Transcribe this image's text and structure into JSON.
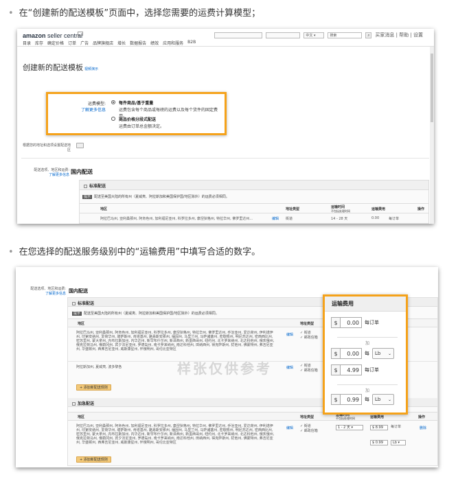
{
  "bullets": [
    "在“创建新的配送模板”页面中，选择您需要的运费计算模型；",
    "在您选择的配送服务级别中的“运输费用”中填写合适的数字。"
  ],
  "shot1": {
    "logo_brand": "amazon",
    "logo_product": " seller central",
    "top_right": {
      "store_select": "",
      "lang_select": "中文",
      "search_placeholder": "搜索",
      "links": "买家消息 | 帮助 | 设置"
    },
    "nav": [
      "目录",
      "库存",
      "确定价格",
      "订单",
      "广告",
      "品牌旗舰店",
      "增长",
      "数据报告",
      "绩效",
      "应用和服务",
      "B2B"
    ],
    "page_title": "创建新的配送模板",
    "page_title_help": "视频演示",
    "model": {
      "label": "运费模型:",
      "more": "了解更多信息",
      "opt1_title": "每件商品/基于重量",
      "opt1_desc": "运费包含每个商品或每磅的运费以及每个货件的固定费用。",
      "opt2_title": "商品价格分段式配送",
      "opt2_desc": "运费由订单总金额决定。"
    },
    "dest_label": "根据您的地址和选项设置配送地区",
    "ship_opts_label": "配送选项、地区和运费:",
    "ship_opts_more": "了解更多信息",
    "domestic": "国内配送",
    "standard": "标准配送",
    "notice_tag": "提示",
    "notice": "配送至美国大陆的所有州（夏威夷、阿拉斯加和美国保护国/地区除外）的运费必须相同。",
    "table_headers": [
      "地区",
      "地址类型",
      "运输时间",
      "运输费用",
      "操作"
    ],
    "transit_sub": "不包括处理时间",
    "row": {
      "region": "阿拉巴马州, 亚利桑那州, 阿肯色州, 加利福尼亚州, 科罗拉多州, 康涅狄格州, 特拉华州, 佛罗里达州...",
      "edit": "编辑",
      "addr": "街道",
      "transit": "14 - 28 天",
      "fee": "0.00",
      "fee_unit": "每订单"
    }
  },
  "shot2": {
    "ship_opts_label": "配送选项、地区和运费:",
    "ship_opts_more": "了解更多信息",
    "domestic": "国内配送",
    "standard": "标准配送",
    "expedited": "加急配送",
    "notice_tag": "提示",
    "notice": "配送至美国大陆的所有州（夏威夷、阿拉斯加和美国保护国/地区除外）的运费必须相同。",
    "table_headers": [
      "地区",
      "地址类型",
      "运输时间",
      "运输费用",
      "操作"
    ],
    "transit_sub": "不包括处理时间",
    "region1": "阿拉巴马州, 亚利桑那州, 阿肯色州, 加利福尼亚州, 科罗拉多州, 康涅狄格州, 特拉华州, 佛罗里达州, 乔治亚州, 爱达荷州, 伊利诺伊州, 印第安纳州, 爱荷华州, 堪萨斯州, 肯塔基州, 路易斯安那州, 缅因州, 马里兰州, 马萨诸塞州, 密歇根州, 明尼苏达州, 密西西比州, 密苏里州, 蒙大拿州, 内布拉斯加州, 内华达州, 新罕布什尔州, 新泽西州, 新墨西哥州, 纽约州, 北卡罗来纳州, 北达科他州, 俄亥俄州, 俄克拉荷马州, 俄勒冈州, 宾夕法尼亚州, 罗德岛州, 南卡罗来纳州, 南达科他州, 田纳西州, 得克萨斯州, 犹他州, 佛蒙特州, 弗吉尼亚州, 华盛顿州, 西弗吉尼亚州, 威斯康星州, 怀俄明州, 哥伦比亚特区",
    "region2": "阿拉斯加州, 夏威夷, 波多黎各",
    "edit": "编辑",
    "addr1": "街道",
    "addr2": "邮政信箱",
    "transit_days": "14",
    "add_rule": "+ 添加新配送规则",
    "expedited_transit": "1 - 2 天",
    "exp_fee1": "8.99",
    "exp_fee1_unit": "每订单",
    "exp_fee2": "0.99",
    "exp_fee2_unit": "Lb",
    "delete": "删除",
    "watermark": "样张仅供参考",
    "fee_box": {
      "title": "运输费用",
      "currency": "$",
      "plus": "加",
      "row1_value": "0.00",
      "row1_unit": "每订单",
      "row2_value": "0.00",
      "row2_per": "每",
      "row2_unit": "Lb",
      "row3_value": "4.99",
      "row3_unit": "每订单",
      "row4_value": "0.99",
      "row4_per": "每",
      "row4_unit": "Lb"
    }
  },
  "colors": {
    "highlight": "#f5a21a",
    "link": "#0066c0",
    "add_button": "#f3c979"
  }
}
